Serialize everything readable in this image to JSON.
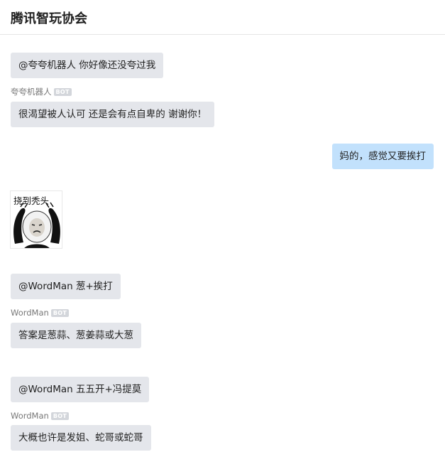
{
  "header": {
    "title": "腾讯智玩协会"
  },
  "badge_label": "BOT",
  "messages": [
    {
      "text": "@夸夸机器人 你好像还没夸过我"
    },
    {
      "sender": "夸夸机器人",
      "text": "很渴望被人认可 还是会有点自卑的 谢谢你！"
    },
    {
      "text": "妈的，感觉又要挨打"
    },
    {
      "sticker_caption": "挠到秃头"
    },
    {
      "text": "@WordMan  葱+挨打"
    },
    {
      "sender": "WordMan",
      "text": "答案是葱蒜、葱姜蒜或大葱"
    },
    {
      "text": "@WordMan 五五开+冯提莫"
    },
    {
      "sender": "WordMan",
      "text": "大概也许是发姐、蛇哥或蛇哥"
    }
  ],
  "colors": {
    "bubble_gray": "#e4e6eb",
    "bubble_self": "#c2e1fc",
    "badge": "#d3d6db"
  },
  "icons": {
    "sticker": "panda-head-scratching-sticker"
  }
}
